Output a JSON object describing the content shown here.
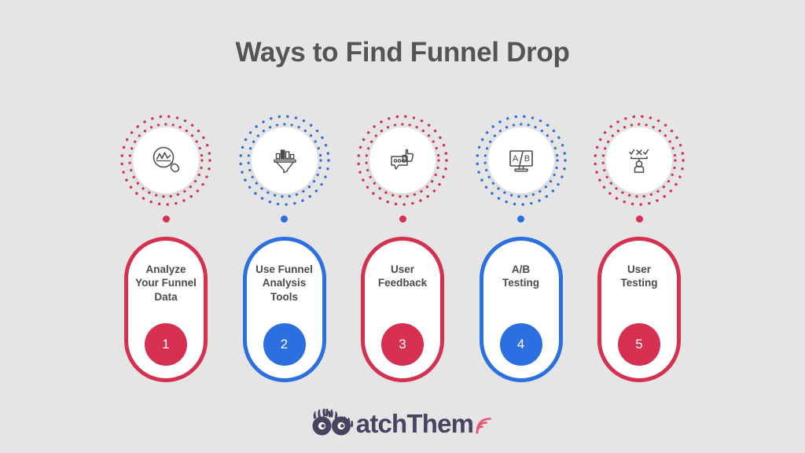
{
  "background_color": "#e5e5e5",
  "header": {
    "title": "Ways to Find Funnel Drop"
  },
  "colors": {
    "red": "#d5304f",
    "blue": "#2b6fe0",
    "title_text": "#545454",
    "card_text": "#4b4b4b",
    "logo_text": "#484360",
    "logo_signal": "#e8546f"
  },
  "steps": [
    {
      "number": "1",
      "label": "Analyze\nYour Funnel\nData",
      "color": "red",
      "icon": "magnifier-chart-icon"
    },
    {
      "number": "2",
      "label": "Use Funnel\nAnalysis\nTools",
      "color": "blue",
      "icon": "funnel-bar-chart-icon"
    },
    {
      "number": "3",
      "label": "User\nFeedback",
      "color": "red",
      "icon": "speech-bubble-thumbs-up-icon"
    },
    {
      "number": "4",
      "label": "A/B\nTesting",
      "color": "blue",
      "icon": "ab-test-monitor-icon"
    },
    {
      "number": "5",
      "label": "User\nTesting",
      "color": "red",
      "icon": "user-test-checkmarks-icon"
    }
  ],
  "footer": {
    "logo_text": "atchThem",
    "logo_mark": "owl-eyes-icon",
    "logo_signal": "signal-waves-icon"
  }
}
